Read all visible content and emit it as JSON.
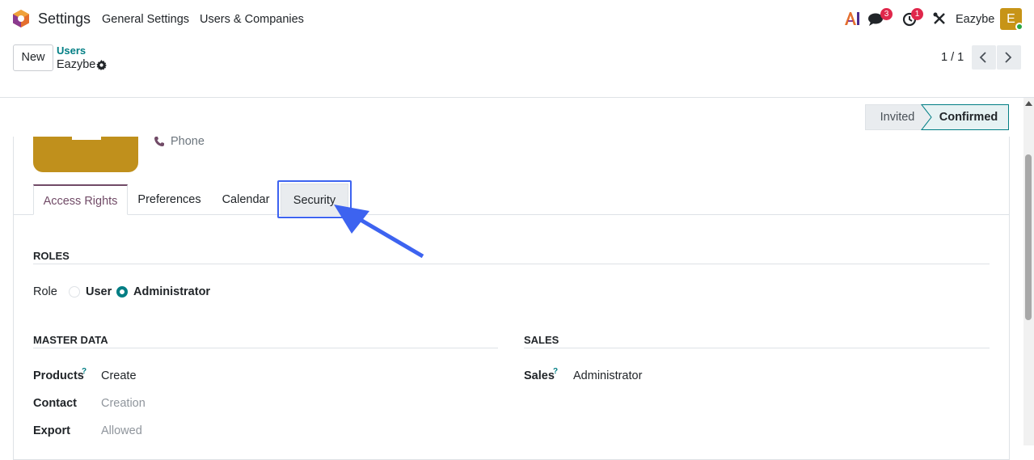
{
  "topbar": {
    "app_name": "Settings",
    "menu": [
      "General Settings",
      "Users & Companies"
    ],
    "messages_count": "3",
    "activities_count": "1",
    "user_name": "Eazybe",
    "avatar_letter": "E"
  },
  "control": {
    "new_label": "New",
    "breadcrumb_parent": "Users",
    "breadcrumb_current": "Eazybe",
    "pager": "1 / 1"
  },
  "status": {
    "invited": "Invited",
    "confirmed": "Confirmed"
  },
  "profile": {
    "phone_placeholder": "Phone"
  },
  "tabs": [
    {
      "label": "Access Rights",
      "active": true
    },
    {
      "label": "Preferences"
    },
    {
      "label": "Calendar"
    },
    {
      "label": "Security",
      "highlighted": true
    }
  ],
  "roles": {
    "title": "ROLES",
    "role_label": "Role",
    "options": [
      {
        "label": "User",
        "checked": false
      },
      {
        "label": "Administrator",
        "checked": true
      }
    ]
  },
  "master_data": {
    "title": "MASTER DATA",
    "rows": [
      {
        "label": "Products",
        "help": "?",
        "value": "Create",
        "muted": false
      },
      {
        "label": "Contact",
        "value": "Creation",
        "muted": true
      },
      {
        "label": "Export",
        "value": "Allowed",
        "muted": true
      }
    ]
  },
  "sales": {
    "title": "SALES",
    "rows": [
      {
        "label": "Sales",
        "help": "?",
        "value": "Administrator"
      }
    ]
  },
  "colors": {
    "brand": "#714b67",
    "accent": "#017e84",
    "highlight": "#3d63f0"
  }
}
